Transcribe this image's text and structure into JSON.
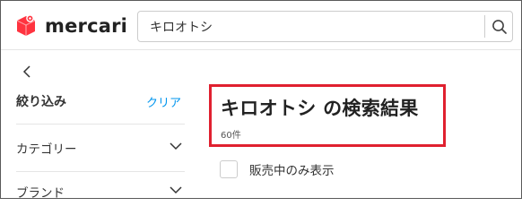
{
  "colors": {
    "brand_red": "#ff333f",
    "accent_blue": "#0095ee",
    "highlight_red": "#e0202f"
  },
  "header": {
    "logo_text": "mercari",
    "logo_icon": "mercari-box-logo-icon",
    "search": {
      "value": "キロオトシ",
      "button_icon": "search-icon"
    }
  },
  "sidebar": {
    "back_icon": "chevron-left-icon",
    "filter_title": "絞り込み",
    "clear_label": "クリア",
    "filters": [
      {
        "label": "カテゴリー",
        "icon": "chevron-down-icon"
      },
      {
        "label": "ブランド",
        "icon": "chevron-down-icon"
      }
    ]
  },
  "main": {
    "title": "キロオトシ の検索結果",
    "result_count": "60件",
    "on_sale_checkbox": {
      "label": "販売中のみ表示",
      "checked": false
    }
  }
}
